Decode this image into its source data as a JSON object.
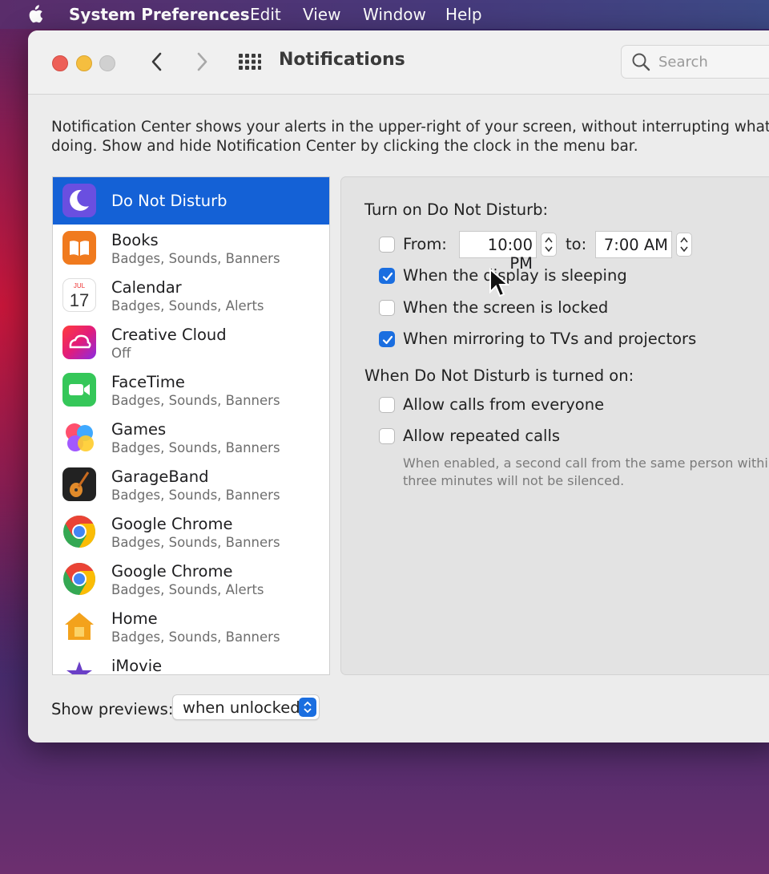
{
  "menubar": {
    "app_name": "System Preferences",
    "items": [
      "Edit",
      "View",
      "Window",
      "Help"
    ]
  },
  "window": {
    "title": "Notifications",
    "search_placeholder": "Search",
    "description_line1": "Notification Center shows your alerts in the upper-right of your screen, without interrupting what yo",
    "description_line2": "doing. Show and hide Notification Center by clicking the clock in the menu bar."
  },
  "apps": [
    {
      "name": "Do Not Disturb",
      "subtitle": "",
      "icon": "moon-icon",
      "selected": true
    },
    {
      "name": "Books",
      "subtitle": "Badges, Sounds, Banners",
      "icon": "books-icon"
    },
    {
      "name": "Calendar",
      "subtitle": "Badges, Sounds, Alerts",
      "icon": "calendar-icon",
      "icon_month": "JUL",
      "icon_day": "17"
    },
    {
      "name": "Creative Cloud",
      "subtitle": "Off",
      "icon": "creative-cloud-icon"
    },
    {
      "name": "FaceTime",
      "subtitle": "Badges, Sounds, Banners",
      "icon": "facetime-icon"
    },
    {
      "name": "Games",
      "subtitle": "Badges, Sounds, Banners",
      "icon": "games-icon"
    },
    {
      "name": "GarageBand",
      "subtitle": "Badges, Sounds, Banners",
      "icon": "garageband-icon"
    },
    {
      "name": "Google Chrome",
      "subtitle": "Badges, Sounds, Banners",
      "icon": "chrome-icon"
    },
    {
      "name": "Google Chrome",
      "subtitle": "Badges, Sounds, Alerts",
      "icon": "chrome-icon"
    },
    {
      "name": "Home",
      "subtitle": "Badges, Sounds, Banners",
      "icon": "home-icon"
    },
    {
      "name": "iMovie",
      "subtitle": "",
      "icon": "imovie-icon"
    }
  ],
  "dnd": {
    "heading": "Turn on Do Not Disturb:",
    "from_label": "From:",
    "from_checked": false,
    "from_time": "10:00 PM",
    "to_label": "to:",
    "to_time": "7:00 AM",
    "options": [
      {
        "label": "When the display is sleeping",
        "checked": true
      },
      {
        "label": "When the screen is locked",
        "checked": false
      },
      {
        "label": "When mirroring to TVs and projectors",
        "checked": true
      }
    ],
    "heading2": "When Do Not Disturb is turned on:",
    "options2": [
      {
        "label": "Allow calls from everyone",
        "checked": false
      },
      {
        "label": "Allow repeated calls",
        "checked": false
      }
    ],
    "note_line1": "When enabled, a second call from the same person within",
    "note_line2": "three minutes will not be silenced."
  },
  "previews": {
    "label": "Show previews:",
    "value": "when unlocked"
  },
  "colors": {
    "accent": "#1461d6",
    "checkbox_on": "#1a6ee0"
  }
}
